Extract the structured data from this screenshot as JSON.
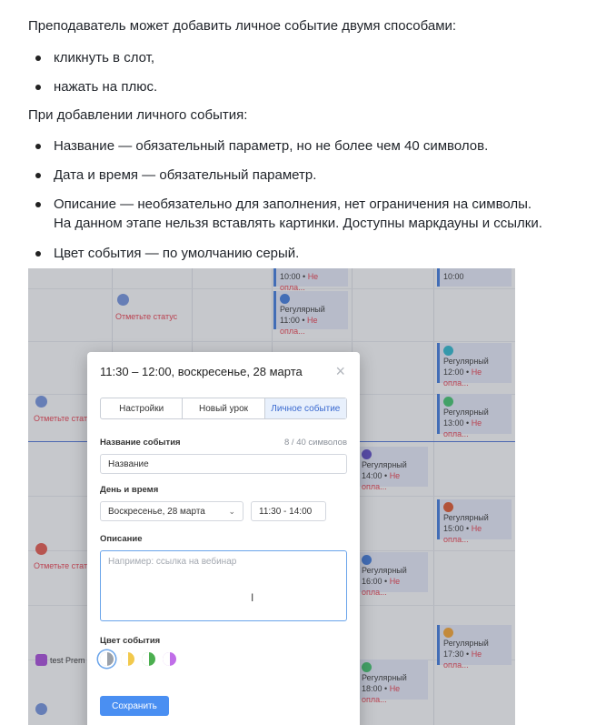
{
  "intro": "Преподаватель может добавить личное событие двумя способами:",
  "ways": [
    "кликнуть в слот,",
    "нажать на плюс."
  ],
  "params_intro": "При добавлении личного события:",
  "params": [
    "Название — обязательный параметр, но не более чем 40 символов.",
    "Дата и время — обязательный параметр.",
    "Описание — необязательно для заполнения, нет ограничения на символы.",
    "На данном этапе нельзя вставлять картинки. Доступны маркдауны и ссылки.",
    "Цвет события — по умолчанию серый."
  ],
  "calendar": {
    "status_label": "Отметьте статус",
    "status_short": "Отметьте стат",
    "regular": "Регулярный",
    "not_paid": "Не опла...",
    "test_label": "test Prem",
    "times": [
      "10:00",
      "11:00",
      "12:00",
      "13:00",
      "14:00",
      "15:00",
      "16:00",
      "17:30",
      "18:00"
    ]
  },
  "modal": {
    "title": "11:30 – 12:00, воскресенье, 28 марта",
    "close": "×",
    "tabs": [
      "Настройки",
      "Новый урок",
      "Личное событие"
    ],
    "name_label": "Название события",
    "name_counter": "8 / 40 символов",
    "name_value": "Название",
    "datetime_label": "День и время",
    "date_value": "Воскресенье, 28 марта",
    "time_value": "11:30 - 14:00",
    "desc_label": "Описание",
    "desc_placeholder": "Например: ссылка на вебинар",
    "color_label": "Цвет события",
    "colors": [
      "#9aa0a8",
      "#f2c94c",
      "#4caf50",
      "#c06ee8"
    ],
    "save": "Сохранить"
  }
}
